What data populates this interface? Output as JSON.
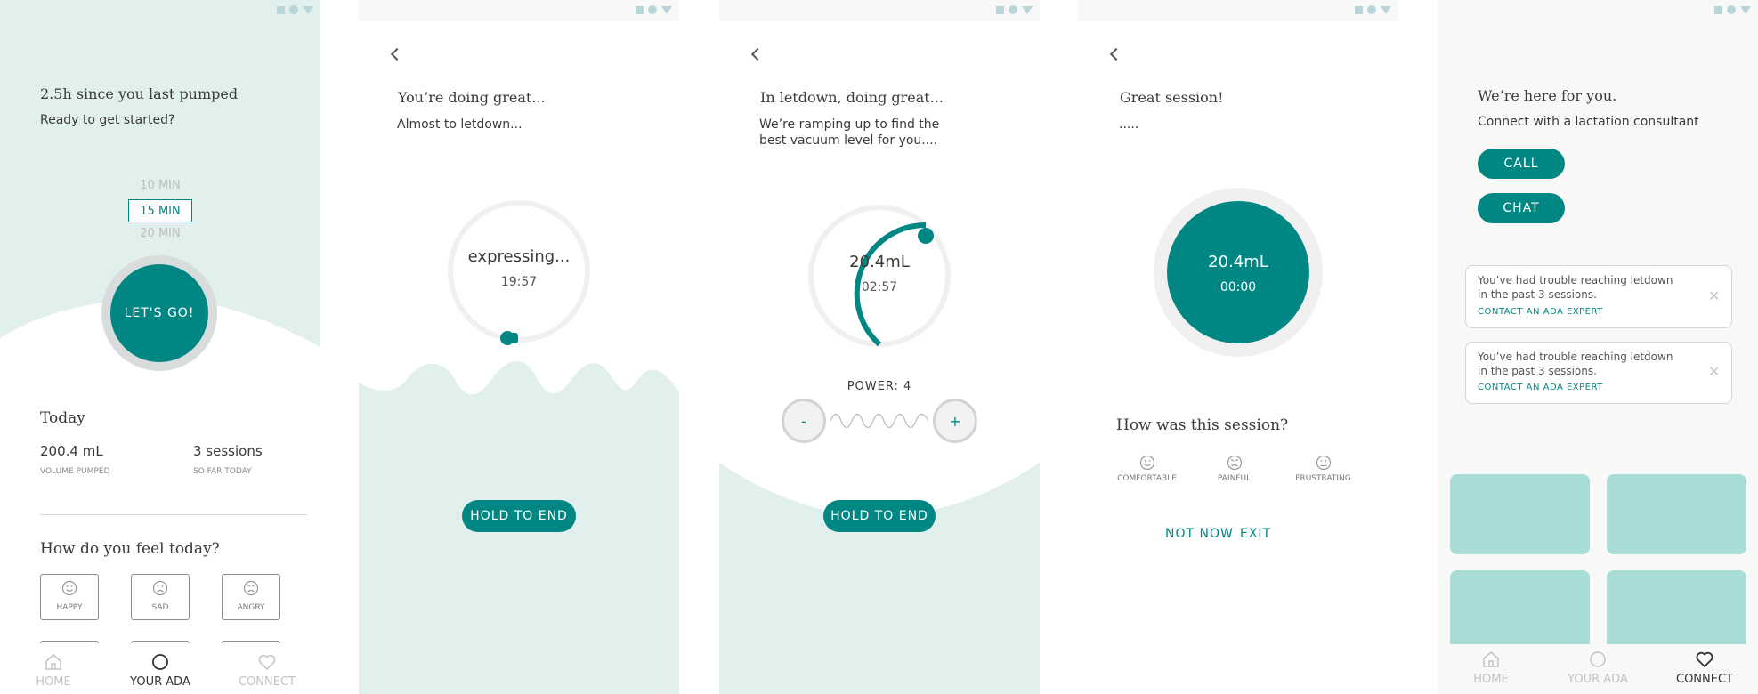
{
  "colors": {
    "teal": "#008784",
    "mint": "#e1efed",
    "tile": "#a8dcd7",
    "status_icons": "#b8d6d9"
  },
  "icons": [
    "square-icon",
    "circle-icon",
    "triangle-icon",
    "back-arrow-icon",
    "home-icon",
    "circle-icon",
    "heart-icon",
    "happy-face-icon",
    "sad-face-icon",
    "angry-face-icon",
    "close-icon"
  ],
  "screen1": {
    "since": "2.5h since you last pumped",
    "ready": "Ready to get started?",
    "durations": [
      "10 MIN",
      "15 MIN",
      "20 MIN"
    ],
    "selected_duration": "15 MIN",
    "go": "LET'S GO!",
    "today": "Today",
    "volume_value": "200.4 mL",
    "volume_label": "VOLUME PUMPED",
    "sessions_value": "3 sessions",
    "sessions_label": "SO FAR TODAY",
    "feel": "How do you feel today?",
    "moods": [
      "HAPPY",
      "SAD",
      "ANGRY"
    ],
    "tabs": {
      "home": "HOME",
      "ada": "YOUR ADA",
      "connect": "CONNECT"
    },
    "active_tab": "YOUR ADA"
  },
  "screen2": {
    "title": "You’re doing great...",
    "subtitle": "Almost to letdown...",
    "status": "expressing...",
    "time": "19:57",
    "hold": "HOLD TO END"
  },
  "screen3": {
    "title": "In letdown, doing great...",
    "subtitle": "We’re ramping up to find the best vacuum level for you....",
    "volume": "20.4mL",
    "time": "02:57",
    "power": "POWER: 4",
    "minus": "-",
    "plus": "+",
    "hold": "HOLD TO END"
  },
  "screen4": {
    "title": "Great session!",
    "dots": ".....",
    "volume": "20.4mL",
    "time": "00:00",
    "question": "How was this session?",
    "ratings": [
      "COMFORTABLE",
      "PAINFUL",
      "FRUSTRATING"
    ],
    "not_now": "NOT NOW",
    "exit": "EXIT"
  },
  "screen5": {
    "title": "We’re here for you.",
    "subtitle": "Connect with a lactation consultant",
    "call": "CALL",
    "chat": "CHAT",
    "alerts": [
      {
        "text": "You’ve had trouble reaching letdown in the past 3 sessions.",
        "link": "CONTACT AN ADA EXPERT"
      },
      {
        "text": "You’ve had trouble reaching letdown in the past 3 sessions.",
        "link": "CONTACT AN ADA EXPERT"
      }
    ],
    "tabs": {
      "home": "HOME",
      "ada": "YOUR ADA",
      "connect": "CONNECT"
    },
    "active_tab": "CONNECT"
  }
}
